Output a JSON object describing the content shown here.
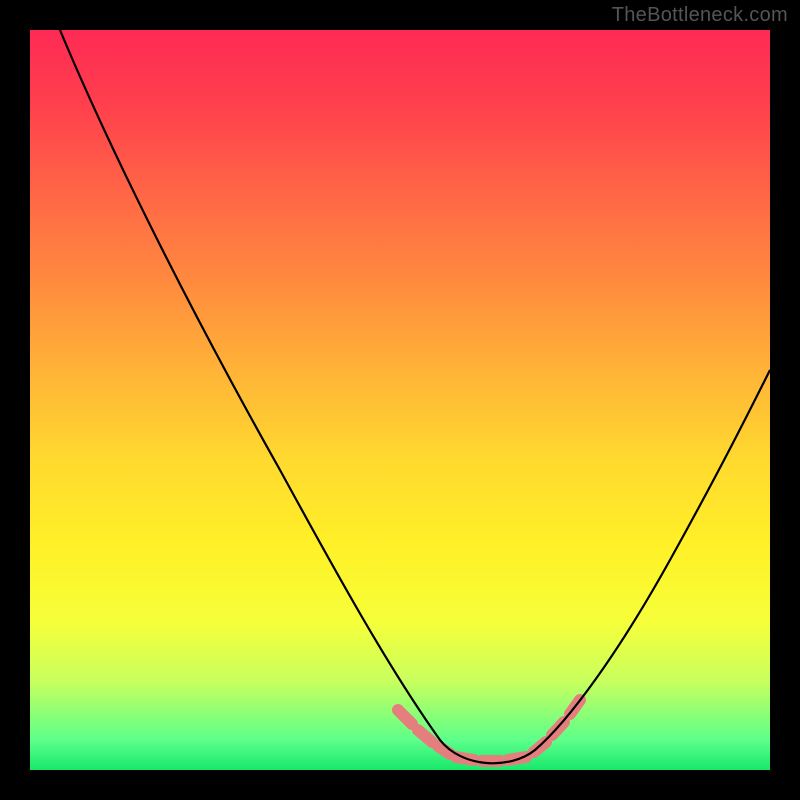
{
  "watermark": "TheBottleneck.com",
  "colors": {
    "background": "#000000",
    "gradient_top": "#ff2a54",
    "gradient_bottom": "#17e86c",
    "curve": "#000000",
    "highlight": "#e57f7d"
  },
  "chart_data": {
    "type": "line",
    "title": "",
    "xlabel": "",
    "ylabel": "",
    "xlim": [
      0,
      100
    ],
    "ylim": [
      0,
      100
    ],
    "series": [
      {
        "name": "bottleneck-curve",
        "x": [
          4,
          10,
          20,
          30,
          40,
          48,
          54,
          58,
          62,
          66,
          70,
          74,
          80,
          88,
          96
        ],
        "y": [
          100,
          90,
          73,
          56,
          38,
          22,
          10,
          4,
          1,
          1,
          4,
          10,
          22,
          40,
          58
        ]
      }
    ],
    "annotations": [
      {
        "name": "left-near-minimum-dashes",
        "x_range": [
          50,
          56
        ],
        "style": "pink-dash"
      },
      {
        "name": "flat-minimum-segment",
        "x_range": [
          57,
          68
        ],
        "style": "pink-dash"
      },
      {
        "name": "right-near-minimum-dashes",
        "x_range": [
          69,
          73
        ],
        "style": "pink-dash"
      }
    ]
  }
}
